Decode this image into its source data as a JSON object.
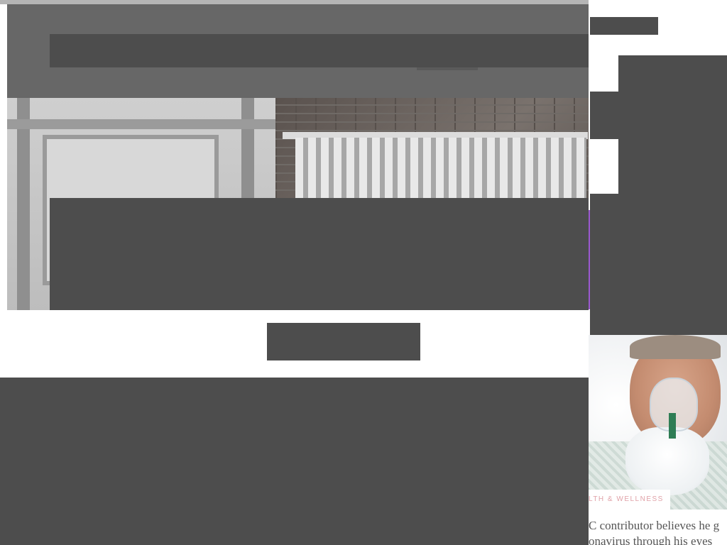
{
  "rail_story": {
    "category": "LTH & WELLNESS",
    "caption_lines": [
      "C contributor believes he g",
      "onavirus through his eyes"
    ]
  },
  "colors": {
    "placeholder": "#4d4d4d",
    "top_band": "#676767",
    "accent": "#9b59d0",
    "category_text": "#e0a2a8"
  }
}
